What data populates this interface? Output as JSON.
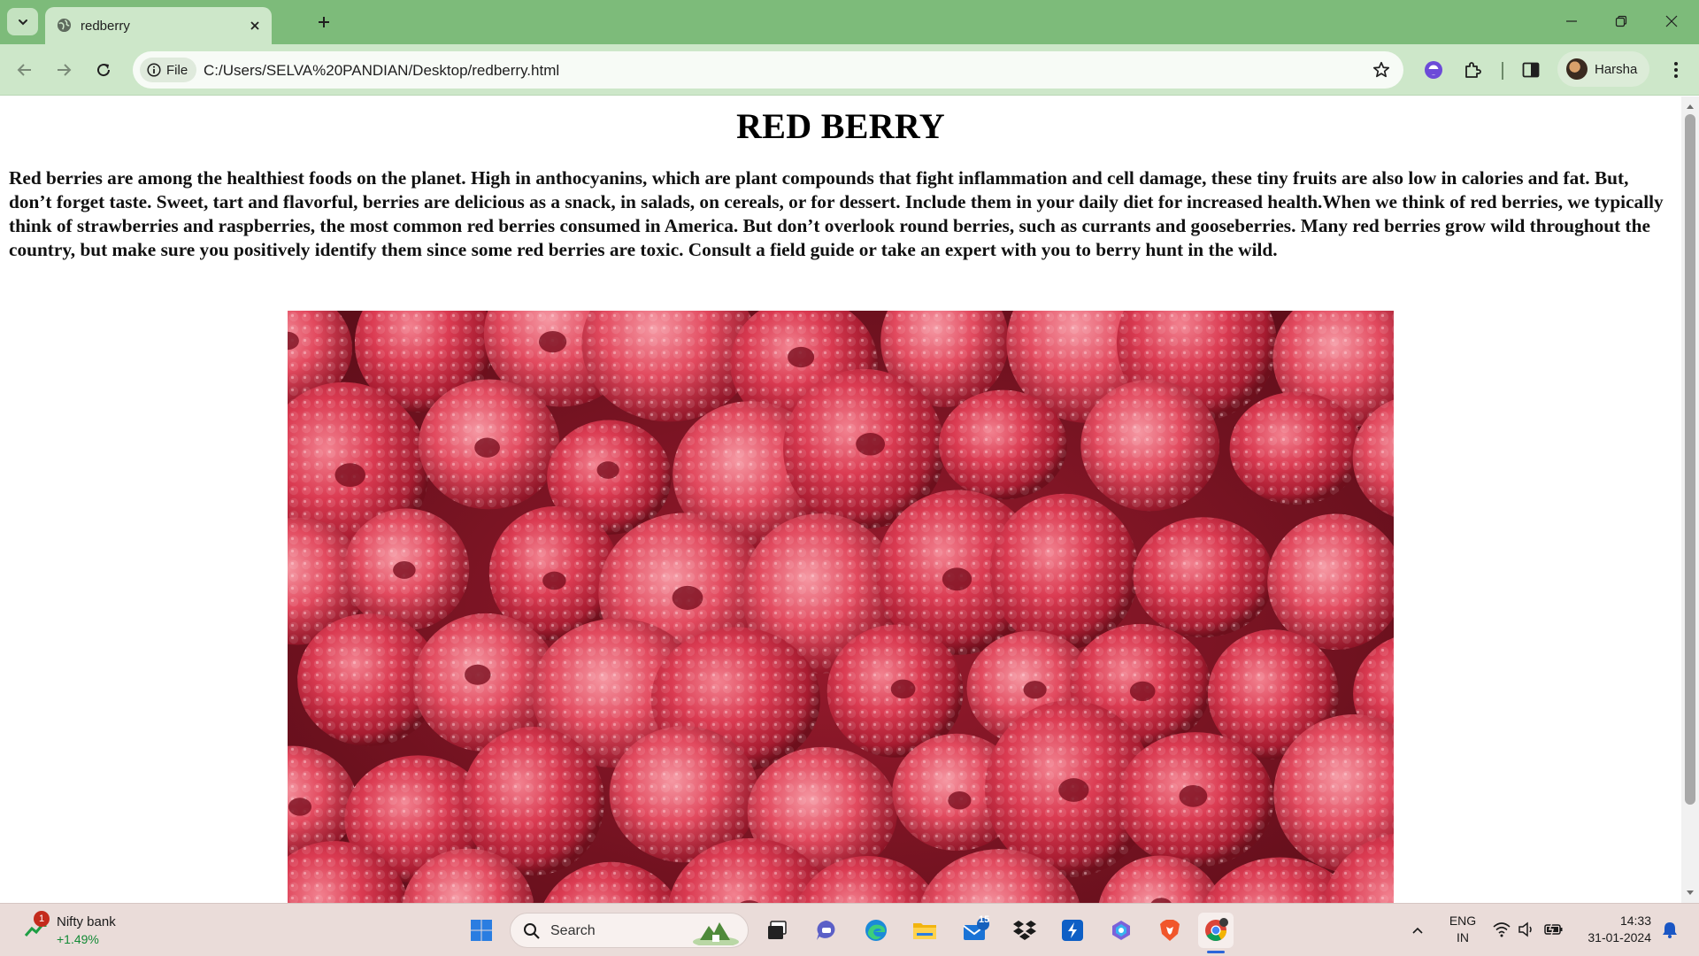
{
  "browser": {
    "tab_title": "redberry",
    "site_chip": "File",
    "url": "C:/Users/SELVA%20PANDIAN/Desktop/redberry.html",
    "profile_name": "Harsha",
    "accent": "#7dbb7a"
  },
  "page": {
    "title": "RED BERRY",
    "paragraph": "Red berries are among the healthiest foods on the planet. High in anthocyanins, which are plant compounds that fight inflammation and cell damage, these tiny fruits are also low in calories and fat. But, don’t forget taste. Sweet, tart and flavorful, berries are delicious as a snack, in salads, on cereals, or for dessert. Include them in your daily diet for increased health.When we think of red berries, we typically think of strawberries and raspberries, the most common red berries consumed in America. But don’t overlook round berries, such as currants and gooseberries. Many red berries grow wild throughout the country, but make sure you positively identify them since some red berries are toxic. Consult a field guide or take an expert with you to berry hunt in the wild.",
    "image_icon": "raspberries-photo"
  },
  "taskbar": {
    "widget_title": "Nifty bank",
    "widget_value": "+1.49%",
    "widget_badge": "1",
    "search_placeholder": "Search",
    "mail_badge": "15",
    "lang_top": "ENG",
    "lang_bottom": "IN",
    "time": "14:33",
    "date": "31-01-2024"
  },
  "icons": [
    "chevron-down-icon",
    "globe-icon",
    "close-icon",
    "plus-icon",
    "minimize-icon",
    "restore-icon",
    "back-icon",
    "forward-icon",
    "reload-icon",
    "info-icon",
    "star-icon",
    "extension-icon",
    "puzzle-icon",
    "side-panel-icon",
    "kebab-menu-icon",
    "windows-start-icon",
    "search-icon",
    "task-view-icon",
    "teams-chat-icon",
    "edge-icon",
    "file-explorer-icon",
    "mail-icon",
    "dropbox-icon",
    "app-icon",
    "copilot-icon",
    "brave-icon",
    "chrome-icon",
    "wifi-icon",
    "volume-icon",
    "battery-icon",
    "notification-bell-icon"
  ]
}
